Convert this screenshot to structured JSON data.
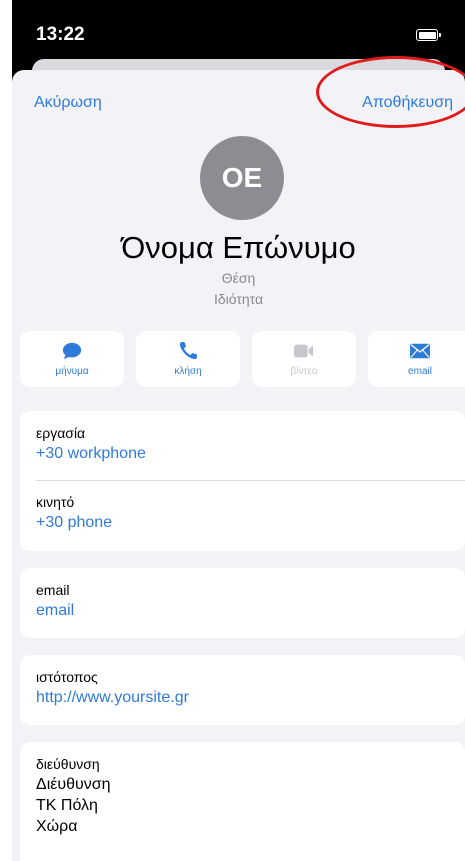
{
  "status_bar": {
    "time": "13:22"
  },
  "nav": {
    "cancel_label": "Ακύρωση",
    "save_label": "Αποθήκευση"
  },
  "header": {
    "initials": "OE",
    "name": "Όνομα Επώνυμο",
    "job_title": "Θέση",
    "company": "Ιδιότητα"
  },
  "actions": [
    {
      "label": "μήνυμα",
      "icon": "message-icon",
      "enabled": true
    },
    {
      "label": "κλήση",
      "icon": "phone-icon",
      "enabled": true
    },
    {
      "label": "βίντεο",
      "icon": "video-icon",
      "enabled": false
    },
    {
      "label": "email",
      "icon": "mail-icon",
      "enabled": true
    }
  ],
  "phones": [
    {
      "label": "εργασία",
      "value": "+30 workphone"
    },
    {
      "label": "κινητό",
      "value": "+30 phone"
    }
  ],
  "email": {
    "label": "email",
    "value": "email"
  },
  "website": {
    "label": "ιστότοπος",
    "value": "http://www.yoursite.gr"
  },
  "address": {
    "label": "διεύθυνση",
    "lines": [
      "Διέυθυνση",
      "ΤΚ Πόλη",
      "Χώρα"
    ]
  },
  "colors": {
    "accent": "#2f7bd9",
    "annotation_circle": "#e11b1b",
    "avatar": "#8c8c92",
    "sheet_background": "#f2f2f7"
  }
}
